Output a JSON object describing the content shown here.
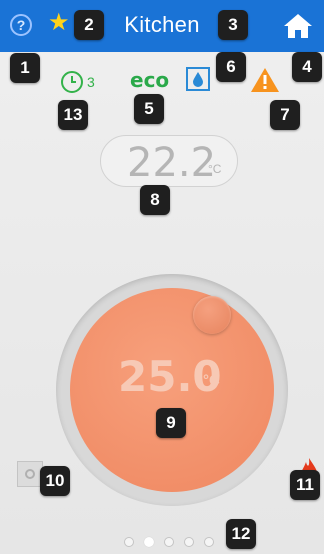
{
  "header": {
    "title": "Kitchen",
    "help_icon": "question-circle-icon",
    "favorite_icon": "star-icon",
    "home_icon": "home-icon"
  },
  "status": {
    "schedule_count": "3",
    "eco_label": "eco"
  },
  "current_temperature": {
    "value": "22.2",
    "unit": "°C"
  },
  "setpoint": {
    "value": "25.0",
    "unit": "°C"
  },
  "pager": {
    "total": 5,
    "active_index": 1
  },
  "badges": [
    "1",
    "2",
    "3",
    "4",
    "5",
    "6",
    "7",
    "8",
    "9",
    "10",
    "11",
    "12",
    "13"
  ],
  "colors": {
    "header": "#1a73d6",
    "dial": "#ef8760",
    "eco": "#2aa94a",
    "warning": "#f7931e",
    "flame": "#e53a1c"
  }
}
